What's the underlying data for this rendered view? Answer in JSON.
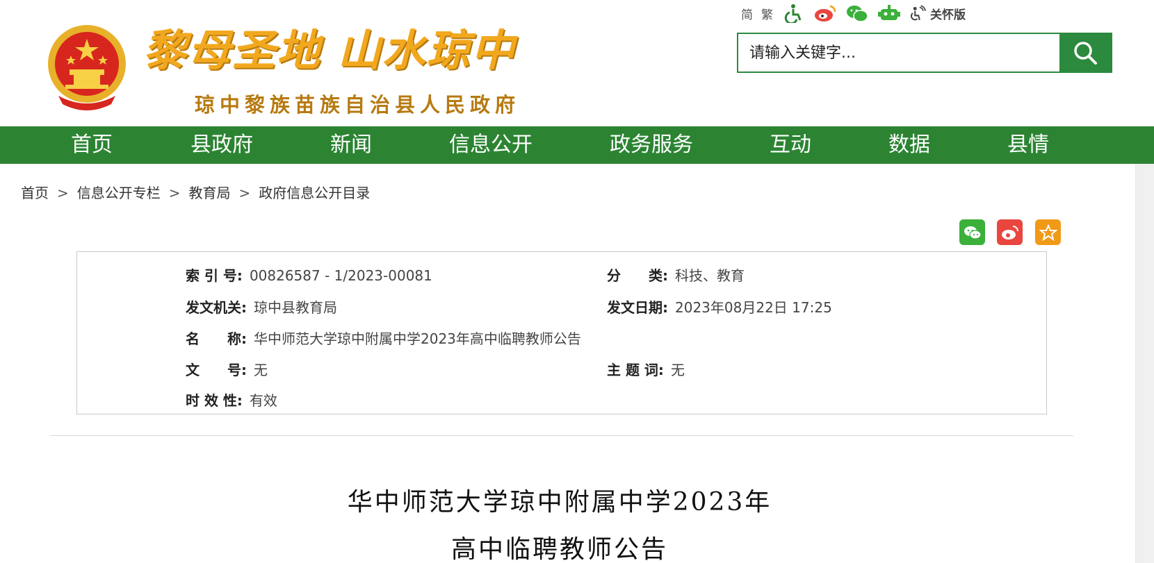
{
  "header": {
    "slogan": "黎母圣地 山水琼中",
    "subtitle": "琼中黎族苗族自治县人民政府",
    "toolbar": {
      "simplified": "简",
      "traditional": "繁",
      "care_mode": "关怀版",
      "icons": [
        "accessibility-icon",
        "weibo-icon",
        "wechat-icon",
        "robot-icon",
        "elderly-care-icon"
      ]
    },
    "search": {
      "placeholder": "请输入关键字..."
    },
    "colors": {
      "brand_green": "#2c8433",
      "slogan_gold": "#f2a81e"
    }
  },
  "nav": {
    "items": [
      {
        "label": "首页"
      },
      {
        "label": "县政府"
      },
      {
        "label": "新闻"
      },
      {
        "label": "信息公开"
      },
      {
        "label": "政务服务"
      },
      {
        "label": "互动"
      },
      {
        "label": "数据"
      },
      {
        "label": "县情"
      }
    ]
  },
  "breadcrumb": {
    "items": [
      "首页",
      "信息公开专栏",
      "教育局",
      "政府信息公开目录"
    ],
    "separator": ">"
  },
  "share": [
    "wechat-icon",
    "weibo-icon",
    "favorite-icon"
  ],
  "info": {
    "index_label": "索 引 号:",
    "index_value": "00826587 - 1/2023-00081",
    "category_label": "分　　类:",
    "category_value": "科技、教育",
    "issuer_label": "发文机关:",
    "issuer_value": "琼中县教育局",
    "date_label": "发文日期:",
    "date_value": "2023年08月22日 17:25",
    "name_label": "名　　称:",
    "name_value": "华中师范大学琼中附属中学2023年高中临聘教师公告",
    "docno_label": "文　　号:",
    "docno_value": "无",
    "keyword_label": "主 题 词:",
    "keyword_value": "无",
    "validity_label": "时 效 性:",
    "validity_value": "有效"
  },
  "article": {
    "title_line1": "华中师范大学琼中附属中学2023年",
    "title_line2": "高中临聘教师公告"
  }
}
